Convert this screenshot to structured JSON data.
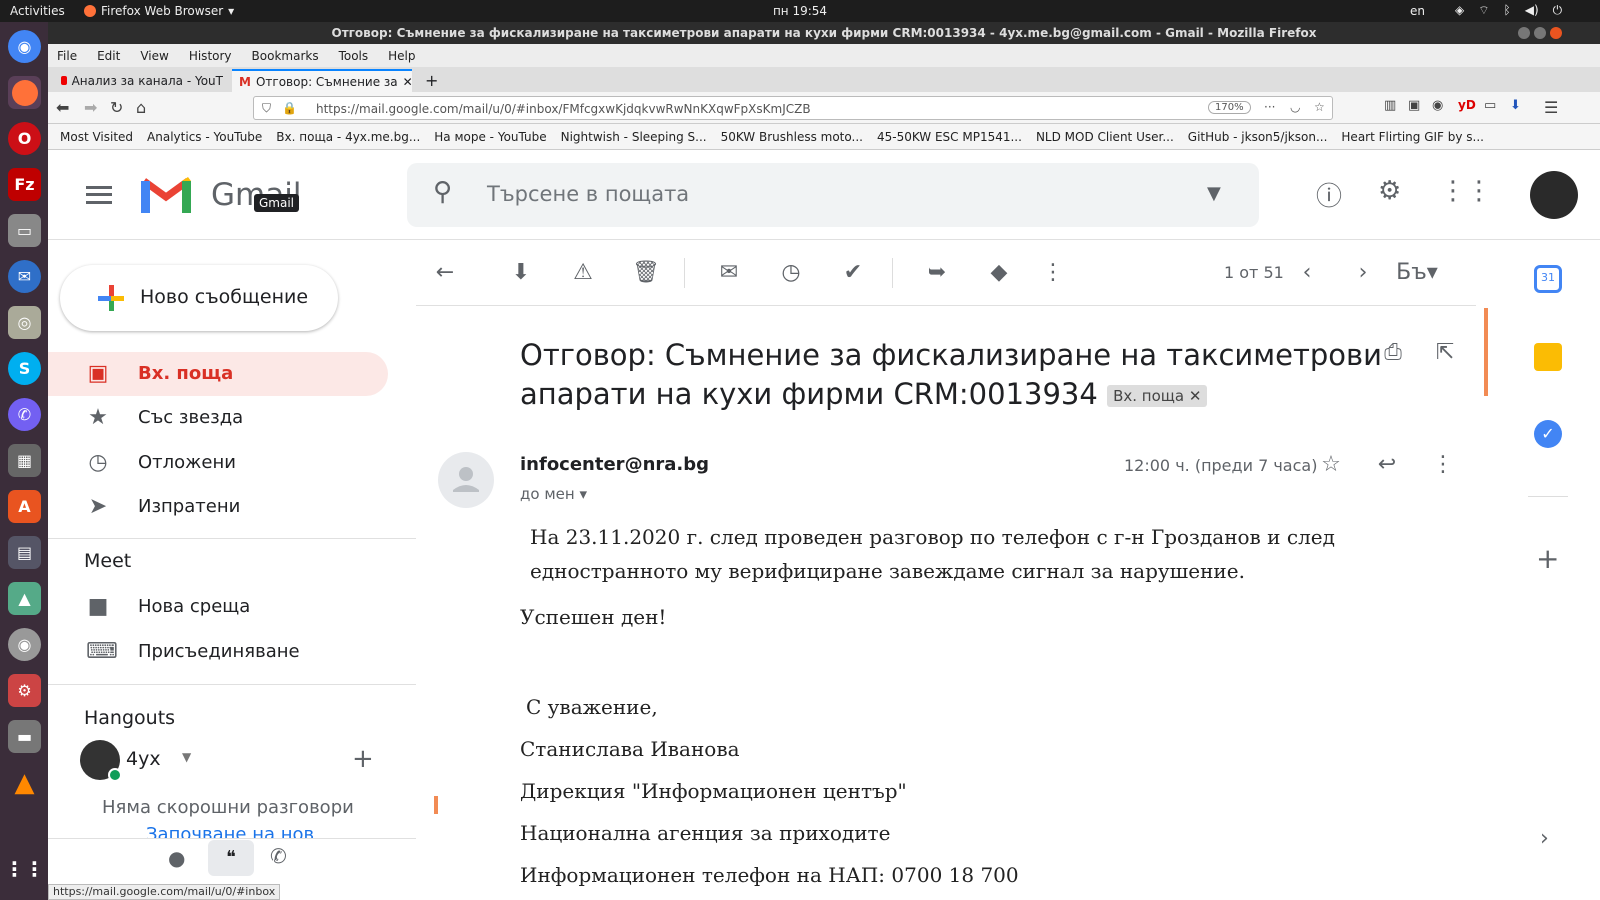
{
  "topbar": {
    "activities": "Activities",
    "app": "Firefox Web Browser",
    "clock": "пн 19:54",
    "lang": "en"
  },
  "window": {
    "title": "Отговор: Съмнение за фискализиране на таксиметрови апарати на кухи фирми CRM:0013934 - 4yx.me.bg@gmail.com - Gmail - Mozilla Firefox"
  },
  "menu": [
    "File",
    "Edit",
    "View",
    "History",
    "Bookmarks",
    "Tools",
    "Help"
  ],
  "tabs": [
    {
      "label": "Анализ за канала - YouT"
    },
    {
      "label": "Отговор: Съмнение за"
    }
  ],
  "nav": {
    "url": "https://mail.google.com/mail/u/0/#inbox/FMfcgxwKjdqkvwRwNnKXqwFpXsKmJCZB",
    "zoom": "170%"
  },
  "bookmarks": [
    "Most Visited",
    "Analytics - YouTube",
    "Вх. поща - 4yx.me.bg...",
    "На море - YouTube",
    "Nightwish - Sleeping S...",
    "50KW Brushless moto...",
    "45-50KW ESC MP1541...",
    "NLD MOD Client User...",
    "GitHub - jkson5/jkson...",
    "Heart Flirting GIF by s..."
  ],
  "gmail": {
    "logo_text": "Gmail",
    "tooltip": "Gmail",
    "search_placeholder": "Търсене в пощата"
  },
  "sidebar": {
    "compose": "Ново съобщение",
    "items": [
      {
        "label": "Вх. поща",
        "icon": "inbox-icon"
      },
      {
        "label": "Със звезда",
        "icon": "star-icon"
      },
      {
        "label": "Отложени",
        "icon": "clock-icon"
      },
      {
        "label": "Изпратени",
        "icon": "send-icon"
      }
    ],
    "meet_title": "Meet",
    "meet": [
      {
        "label": "Нова среща"
      },
      {
        "label": "Присъединяване"
      }
    ],
    "hangouts_title": "Hangouts",
    "hangouts_user": "4yx",
    "no_chats": "Няма скорошни разговори",
    "start_chat": "Започване на нов"
  },
  "toolbar": {
    "pager": "1 от 51"
  },
  "email": {
    "subject": "Отговор: Съмнение за фискализиране на таксиметрови апарати на кухи фирми CRM:0013934",
    "label_chip": "Вх. поща",
    "sender": "infocenter@nra.bg",
    "to": "до мен",
    "time": "12:00 ч. (преди 7 часа)",
    "body": [
      "На 23.11.2020 г. след проведен разговор по телефон с г-н Грозданов и след едностранното му верифициране завеждаме сигнал за нарушение.",
      "Успешен ден!",
      "С уважение,",
      "Станислава Иванова",
      "Дирекция \"Информационен център\"",
      "Национална агенция за приходите",
      "Информационен телефон на НАП: 0700 18 700"
    ]
  },
  "status": "https://mail.google.com/mail/u/0/#inbox",
  "colors": {
    "gmail_red": "#d93025",
    "selected_bg": "#fce8e6",
    "dock": "#3b2d3a"
  }
}
